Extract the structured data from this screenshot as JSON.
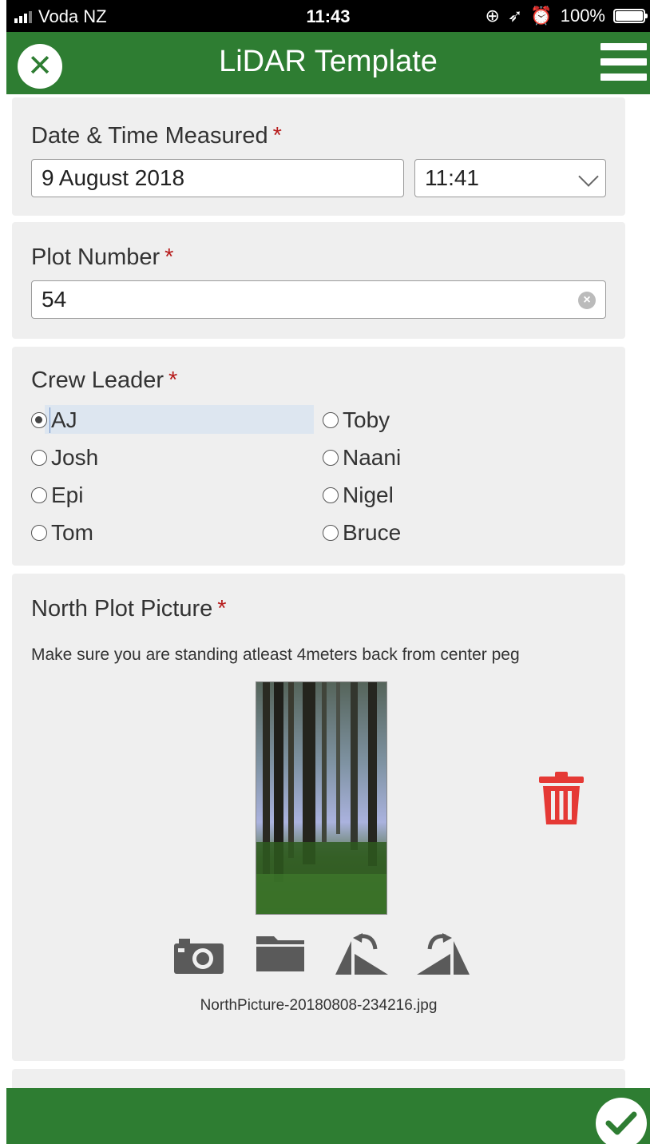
{
  "status_bar": {
    "carrier": "Voda NZ",
    "time": "11:43",
    "battery": "100%"
  },
  "header": {
    "title": "LiDAR Template"
  },
  "date_time": {
    "label": "Date & Time Measured",
    "required_mark": "*",
    "date_value": "9 August 2018",
    "time_value": "11:41"
  },
  "plot_number": {
    "label": "Plot Number",
    "required_mark": "*",
    "value": "54"
  },
  "crew_leader": {
    "label": "Crew Leader",
    "required_mark": "*",
    "selected": "AJ",
    "options": [
      "AJ",
      "Toby",
      "Josh",
      "Naani",
      "Epi",
      "Nigel",
      "Tom",
      "Bruce"
    ]
  },
  "north_picture": {
    "label": "North Plot Picture",
    "required_mark": "*",
    "hint": "Make sure you are standing atleast 4meters back from center peg",
    "filename": "NorthPicture-20180808-234216.jpg"
  },
  "colors": {
    "brand_green": "#2e7d32",
    "required_red": "#b71c1c",
    "trash_red": "#e53935"
  },
  "icons": [
    "close-icon",
    "menu-icon",
    "clear-icon",
    "chevron-down-icon",
    "trash-icon",
    "camera-icon",
    "folder-icon",
    "rotate-left-icon",
    "rotate-right-icon",
    "checkmark-icon"
  ]
}
